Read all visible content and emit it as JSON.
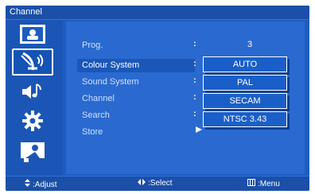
{
  "window": {
    "title": "Channel"
  },
  "sidebar": {
    "items": [
      {
        "icon": "picture-icon"
      },
      {
        "icon": "satellite-dish-icon",
        "active": true
      },
      {
        "icon": "sound-icon"
      },
      {
        "icon": "settings-gear-icon"
      },
      {
        "icon": "person-screen-icon"
      }
    ]
  },
  "menu": {
    "items": [
      {
        "label": "Prog.",
        "value": "3"
      },
      {
        "label": "Colour System",
        "selected": true
      },
      {
        "label": "Sound System"
      },
      {
        "label": "Channel"
      },
      {
        "label": "Search"
      },
      {
        "label": "Store"
      }
    ],
    "separator": ":"
  },
  "dropdown": {
    "options": [
      "AUTO",
      "PAL",
      "SECAM",
      "NTSC 3.43"
    ]
  },
  "footer": {
    "adjust": ":Adjust",
    "select": ":Select",
    "menu": ":Menu"
  },
  "colors": {
    "background": "#1e5cbf",
    "panel": "#2a6ad0",
    "accent": "#ffffff"
  }
}
